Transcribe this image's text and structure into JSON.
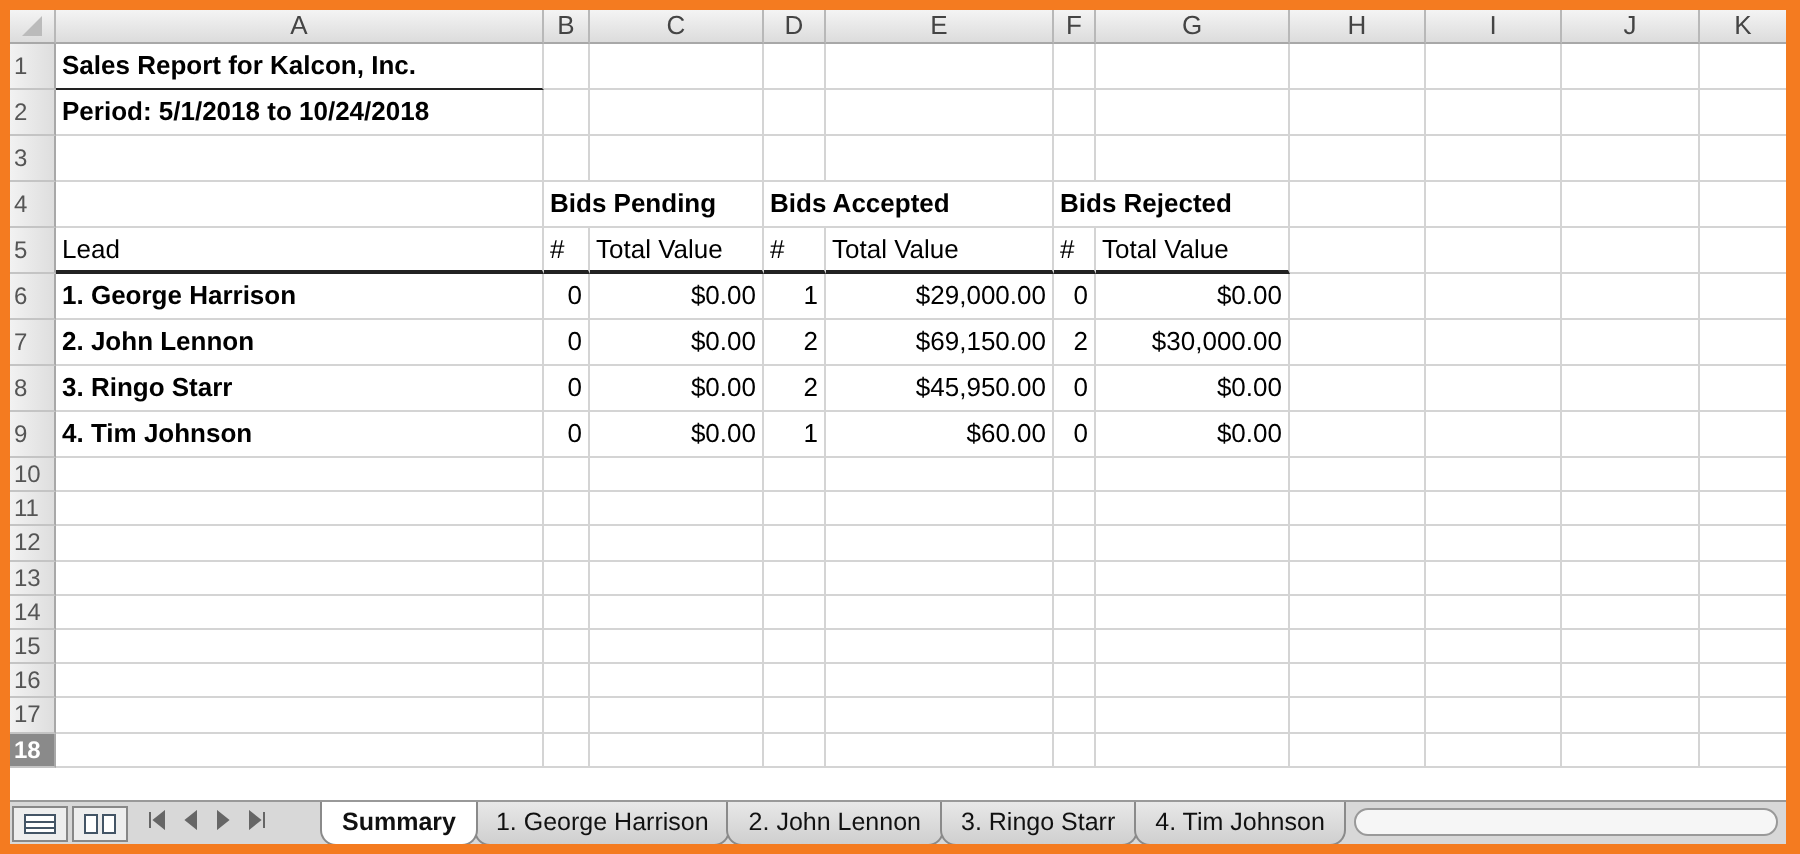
{
  "columns": [
    "A",
    "B",
    "C",
    "D",
    "E",
    "F",
    "G",
    "H",
    "I",
    "J",
    "K"
  ],
  "rows": [
    {
      "number": "1",
      "selected": false,
      "cells": [
        {
          "text": "Sales Report for Kalcon, Inc.",
          "kind": "title",
          "underlined": true
        }
      ]
    },
    {
      "number": "2",
      "selected": false,
      "cells": [
        {
          "text": "Period: 5/1/2018 to 10/24/2018",
          "kind": "title"
        }
      ]
    },
    {
      "number": "3",
      "selected": false,
      "cells": []
    },
    {
      "number": "4",
      "selected": false,
      "cells": [
        null,
        {
          "text": "Bids Pending",
          "kind": "group"
        },
        null,
        {
          "text": "Bids Accepted",
          "kind": "group"
        },
        null,
        {
          "text": "Bids Rejected",
          "kind": "group"
        }
      ]
    },
    {
      "number": "5",
      "selected": false,
      "cells": [
        {
          "text": "Lead",
          "kind": "header",
          "thick_underline": true
        },
        {
          "text": "#",
          "kind": "header",
          "thick_underline": true
        },
        {
          "text": "Total Value",
          "kind": "header",
          "thick_underline": true
        },
        {
          "text": "#",
          "kind": "header",
          "thick_underline": true
        },
        {
          "text": "Total Value",
          "kind": "header",
          "thick_underline": true
        },
        {
          "text": "#",
          "kind": "header",
          "thick_underline": true
        },
        {
          "text": "Total Value",
          "kind": "header",
          "thick_underline": true
        }
      ]
    },
    {
      "number": "6",
      "selected": false,
      "cells": [
        {
          "text": "1. George Harrison",
          "kind": "lead"
        },
        {
          "text": "0",
          "kind": "number"
        },
        {
          "text": "$0.00",
          "kind": "number"
        },
        {
          "text": "1",
          "kind": "number"
        },
        {
          "text": "$29,000.00",
          "kind": "number"
        },
        {
          "text": "0",
          "kind": "number"
        },
        {
          "text": "$0.00",
          "kind": "number"
        }
      ]
    },
    {
      "number": "7",
      "selected": false,
      "cells": [
        {
          "text": "2. John Lennon",
          "kind": "lead"
        },
        {
          "text": "0",
          "kind": "number"
        },
        {
          "text": "$0.00",
          "kind": "number"
        },
        {
          "text": "2",
          "kind": "number"
        },
        {
          "text": "$69,150.00",
          "kind": "number"
        },
        {
          "text": "2",
          "kind": "number"
        },
        {
          "text": "$30,000.00",
          "kind": "number"
        }
      ]
    },
    {
      "number": "8",
      "selected": false,
      "cells": [
        {
          "text": "3. Ringo Starr",
          "kind": "lead"
        },
        {
          "text": "0",
          "kind": "number"
        },
        {
          "text": "$0.00",
          "kind": "number"
        },
        {
          "text": "2",
          "kind": "number"
        },
        {
          "text": "$45,950.00",
          "kind": "number"
        },
        {
          "text": "0",
          "kind": "number"
        },
        {
          "text": "$0.00",
          "kind": "number"
        }
      ]
    },
    {
      "number": "9",
      "selected": false,
      "cells": [
        {
          "text": "4. Tim Johnson",
          "kind": "lead"
        },
        {
          "text": "0",
          "kind": "number"
        },
        {
          "text": "$0.00",
          "kind": "number"
        },
        {
          "text": "1",
          "kind": "number"
        },
        {
          "text": "$60.00",
          "kind": "number"
        },
        {
          "text": "0",
          "kind": "number"
        },
        {
          "text": "$0.00",
          "kind": "number"
        }
      ]
    },
    {
      "number": "10",
      "selected": false,
      "cells": []
    },
    {
      "number": "11",
      "selected": false,
      "cells": []
    },
    {
      "number": "12",
      "selected": false,
      "cells": []
    },
    {
      "number": "13",
      "selected": false,
      "cells": []
    },
    {
      "number": "14",
      "selected": false,
      "cells": []
    },
    {
      "number": "15",
      "selected": false,
      "cells": []
    },
    {
      "number": "16",
      "selected": false,
      "cells": []
    },
    {
      "number": "17",
      "selected": false,
      "cells": []
    },
    {
      "number": "18",
      "selected": true,
      "cells": []
    }
  ],
  "sheet_tabs": [
    {
      "label": "Summary",
      "selected": true
    },
    {
      "label": "1. George Harrison",
      "selected": false
    },
    {
      "label": "2. John Lennon",
      "selected": false
    },
    {
      "label": "3. Ringo Starr",
      "selected": false
    },
    {
      "label": "4. Tim Johnson",
      "selected": false
    }
  ]
}
